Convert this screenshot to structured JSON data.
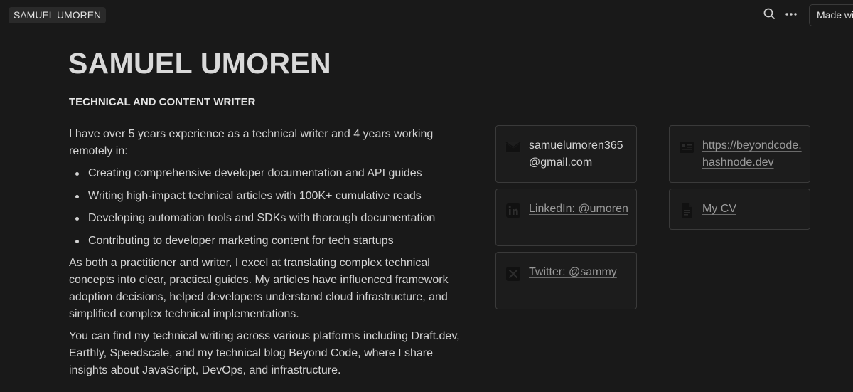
{
  "topbar": {
    "breadcrumb": "SAMUEL UMOREN",
    "made_with_label": "Made wi",
    "search_icon": "search-icon",
    "more_icon": "more-horizontal-icon"
  },
  "page": {
    "title": "SAMUEL UMOREN",
    "subtitle": "TECHNICAL AND CONTENT WRITER",
    "intro": "I have over 5 years experience as a technical writer and 4 years working remotely in:",
    "bullets": [
      "Creating comprehensive developer documentation and API guides",
      "Writing high-impact technical articles with 100K+ cumulative reads",
      "Developing automation tools and SDKs with thorough documentation",
      "Contributing to developer marketing content for tech startups"
    ],
    "paragraph2": "As both a practitioner and writer, I excel at translating complex technical concepts into clear, practical guides. My articles have influenced framework adoption decisions, helped developers understand cloud infrastructure, and simplified complex technical implementations.",
    "paragraph3": "You can find my technical writing across various platforms including Draft.dev, Earthly, Speedscale, and my technical blog Beyond Code, where I share insights about JavaScript, DevOps, and infrastructure."
  },
  "cards": {
    "email": {
      "text": "samuelumoren365@gmail.com",
      "icon": "mail-icon"
    },
    "linkedin": {
      "text": "LinkedIn: @umoren",
      "icon": "linkedin-icon"
    },
    "twitter": {
      "text": "Twitter: @sammy",
      "icon": "x-twitter-icon"
    },
    "blog": {
      "text": "https://beyondcode.hashnode.dev",
      "icon": "blog-icon"
    },
    "cv": {
      "text": "My CV",
      "icon": "document-icon"
    }
  },
  "colors": {
    "background": "#191919",
    "text": "#d4d4d4",
    "link": "#9b9b9b",
    "border": "#3a3a3a"
  }
}
